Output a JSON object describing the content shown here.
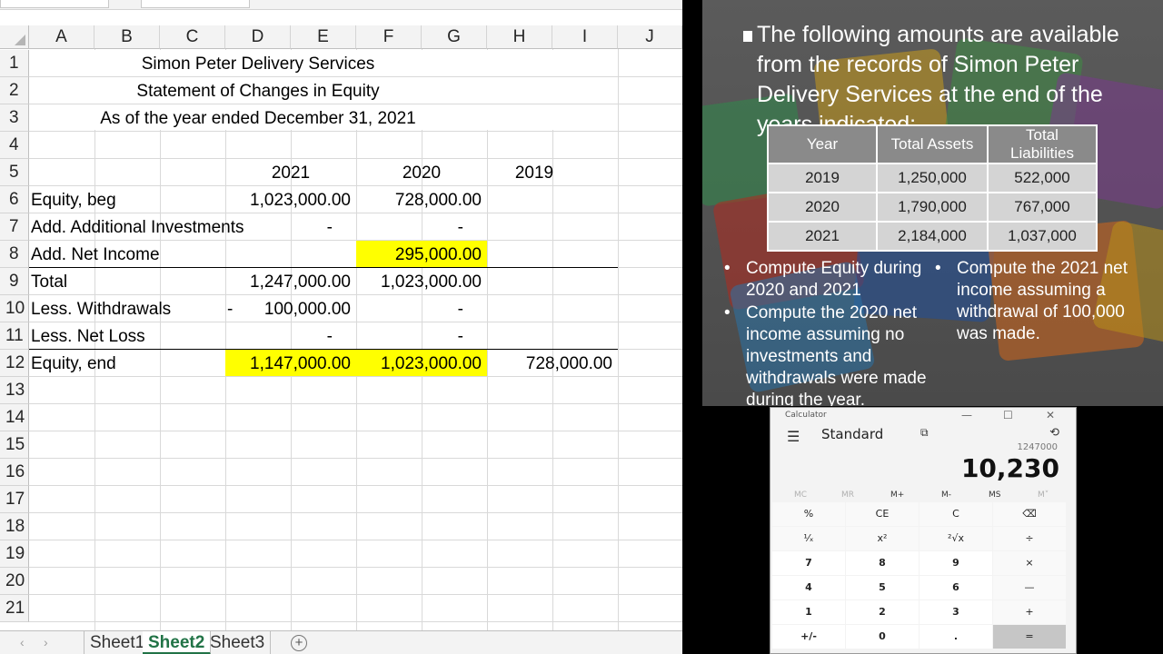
{
  "spreadsheet": {
    "columns": [
      "A",
      "B",
      "C",
      "D",
      "E",
      "F",
      "G",
      "H",
      "I",
      "J"
    ],
    "rows": [
      "1",
      "2",
      "3",
      "4",
      "5",
      "6",
      "7",
      "8",
      "9",
      "10",
      "11",
      "12",
      "13",
      "14",
      "15",
      "16",
      "17",
      "18",
      "19",
      "20",
      "21"
    ],
    "title1": "Simon Peter Delivery Services",
    "title2": "Statement of Changes in Equity",
    "title3": "As of the year ended December 31, 2021",
    "year_headers": [
      "2021",
      "2020",
      "2019"
    ],
    "labels": {
      "r6": "Equity, beg",
      "r7": "Add. Additional Investments",
      "r8": "Add. Net Income",
      "r9": "Total",
      "r10": "Less. Withdrawals",
      "r11": "Less. Net Loss",
      "r12": "Equity, end"
    },
    "values": {
      "e6": "1,023,000.00",
      "g6": "728,000.00",
      "e7": "-",
      "g7": "-",
      "g8": "295,000.00",
      "e9": "1,247,000.00",
      "g9": "1,023,000.00",
      "c10": "-",
      "e10": "100,000.00",
      "g10": "-",
      "e11": "-",
      "g11": "-",
      "e12": "1,147,000.00",
      "g12": "1,023,000.00",
      "i12": "728,000.00"
    },
    "highlight_color": "#ffff00",
    "tabs": [
      "Sheet1",
      "Sheet2",
      "Sheet3"
    ],
    "active_tab": "Sheet2",
    "add_sheet_icon": "plus-circle-icon",
    "nav_prev": "‹",
    "nav_next": "›"
  },
  "slide": {
    "intro": "The following amounts are available from the records of Simon Peter Delivery Services at the end of the years indicated:",
    "table_headers": [
      "Year",
      "Total Assets",
      "Total Liabilities"
    ],
    "table_rows": [
      [
        "2019",
        "1,250,000",
        "522,000"
      ],
      [
        "2020",
        "1,790,000",
        "767,000"
      ],
      [
        "2021",
        "2,184,000",
        "1,037,000"
      ]
    ],
    "bullets_left": [
      "Compute Equity during 2020 and 2021",
      "Compute the 2020 net income assuming no investments and withdrawals were made during the year."
    ],
    "bullets_right": [
      "Compute the 2021 net income assuming a withdrawal of 100,000 was made."
    ],
    "bullet_char": "•"
  },
  "calculator": {
    "title": "Calculator",
    "mode": "Standard",
    "expression": "1247000",
    "display": "10,230",
    "window_controls": [
      "—",
      "☐",
      "✕"
    ],
    "memory": [
      "MC",
      "MR",
      "M+",
      "M-",
      "MS",
      "M˅"
    ],
    "keys": [
      [
        "%",
        "CE",
        "C",
        "⌫"
      ],
      [
        "¹⁄ₓ",
        "x²",
        "²√x",
        "÷"
      ],
      [
        "7",
        "8",
        "9",
        "×"
      ],
      [
        "4",
        "5",
        "6",
        "—"
      ],
      [
        "1",
        "2",
        "3",
        "+"
      ],
      [
        "+/-",
        "0",
        ".",
        "="
      ]
    ]
  }
}
